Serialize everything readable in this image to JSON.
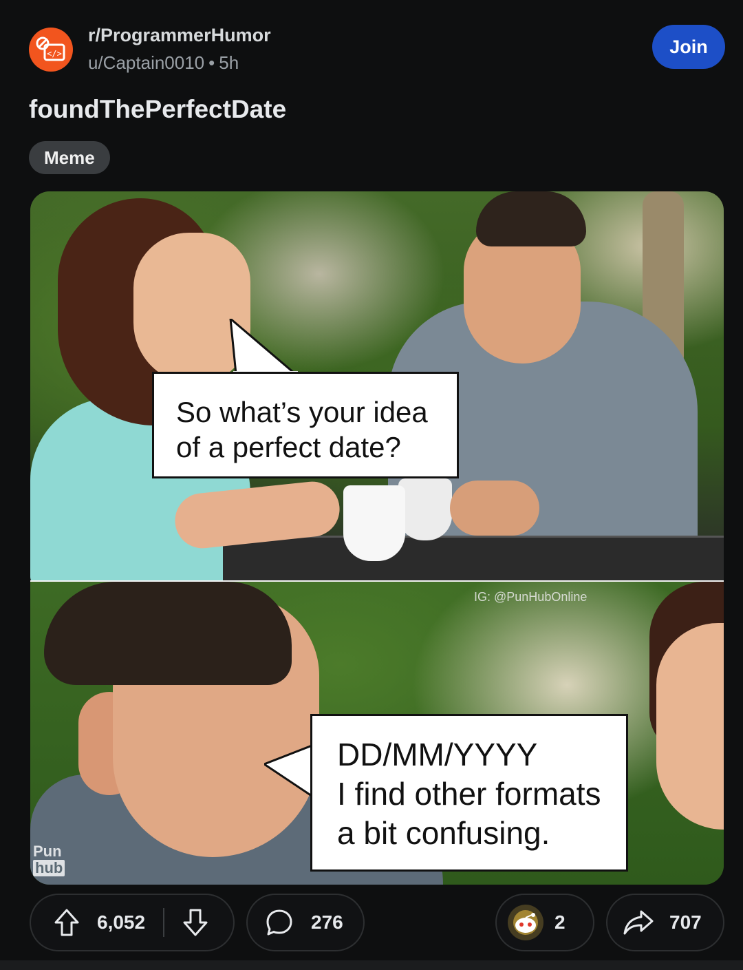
{
  "post": {
    "subreddit": "r/ProgrammerHumor",
    "author": "u/Captain0010",
    "age": "5h",
    "join_label": "Join",
    "title": "foundThePerfectDate",
    "flair": "Meme"
  },
  "meme": {
    "panel1": {
      "bubble_line1": "So what’s your idea",
      "bubble_line2": "of a perfect date?"
    },
    "panel2": {
      "bubble_line1": "DD/MM/YYYY",
      "bubble_line2": "I find other formats",
      "bubble_line3": "a bit confusing."
    },
    "watermark": "IG: @PunHubOnline",
    "logo_top": "Pun",
    "logo_bottom": "hub"
  },
  "actions": {
    "upvotes": "6,052",
    "comments": "276",
    "awards": "2",
    "shares": "707"
  },
  "colors": {
    "join_button": "#1d4fc7",
    "subreddit_avatar": "#f2551e",
    "background": "#0e0f10"
  },
  "icons": {
    "avatar": "code-brackets-icon",
    "upvote": "arrow-up-icon",
    "downvote": "arrow-down-icon",
    "comment": "comment-bubble-icon",
    "award": "award-snoo-icon",
    "share": "share-arrow-icon"
  }
}
